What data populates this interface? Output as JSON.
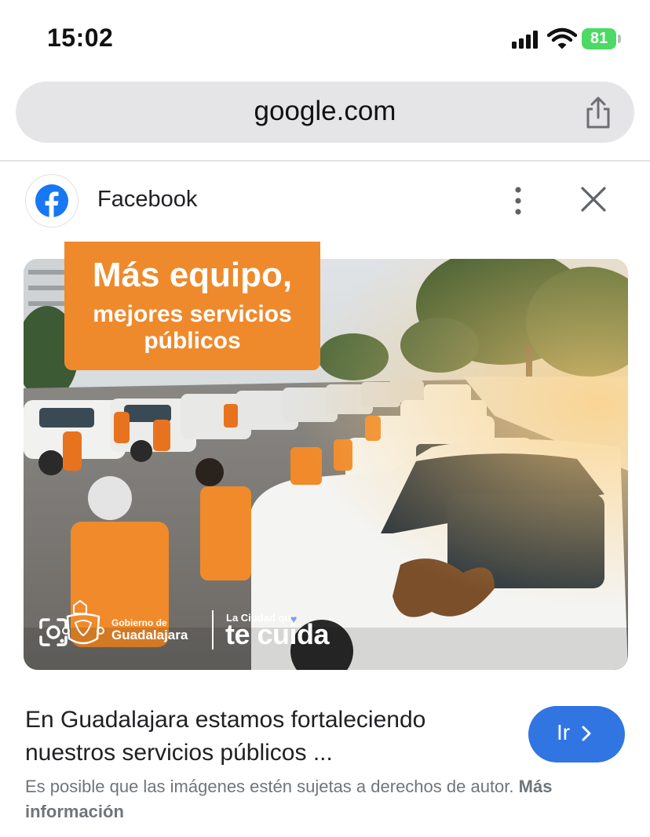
{
  "status_bar": {
    "time": "15:02",
    "battery": "81"
  },
  "browser": {
    "url": "google.com"
  },
  "result": {
    "source": "Facebook",
    "image": {
      "headline_line1": "Más equipo,",
      "headline_line2": "mejores servicios",
      "headline_line3": "públicos",
      "gov_small": "Gobierno de",
      "gov_big": "Guadalajara",
      "tagline_small": "La Ciudad que",
      "tagline_big": "te cuida"
    },
    "caption": "En Guadalajara estamos fortaleciendo nuestros servicios públicos ...",
    "go_button": "Ir",
    "copyright_text": "Es posible que las imágenes estén sujetas a derechos de autor.",
    "more_info": "Más información"
  },
  "colors": {
    "accent": "#3175e3",
    "banner": "#ee8a2c",
    "battery": "#4cd964",
    "facebook": "#1877f2"
  },
  "icons": [
    "signal-icon",
    "wifi-icon",
    "share-icon",
    "facebook-icon",
    "more-vert-icon",
    "close-icon",
    "lens-icon",
    "chevron-right-icon"
  ]
}
